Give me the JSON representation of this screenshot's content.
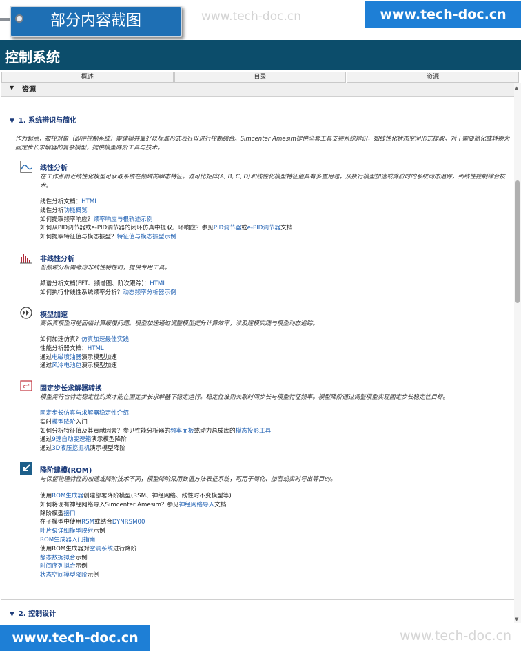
{
  "watermark": {
    "badge": "部分内容截图",
    "text": "www.tech-doc.cn",
    "url": "www.tech-doc.cn"
  },
  "header": {
    "title": "控制系统"
  },
  "tabs": [
    "概述",
    "目录",
    "资源"
  ],
  "resources": {
    "label": "资源"
  },
  "section1": {
    "title": "1. 系统辨识与简化",
    "intro": "作为起点，被控对象（即待控制系统）需建模并最好以标准形式表征以进行控制综合。Simcenter Amesim提供全套工具支持系统辨识，如线性化状态空间形式提取。对于需要简化或转换为固定步长求解器的复杂模型，提供模型降阶工具与技术。"
  },
  "linear": {
    "title": "线性分析",
    "desc": "在工作点附近线性化模型可获取系统在频域的瞬态特征。雅可比矩阵(A, B, C, D)和线性化模型特征值具有多重用途，从执行模型加速或降阶时的系统动态追踪，到线性控制综合技术。",
    "l1": "线性分析文档：",
    "l1_link": "HTML",
    "l2": "线性分析",
    "l2_link": "功能概览",
    "l3": "如何提取频率响应？",
    "l3_link": "频率响应与根轨迹示例",
    "l4a": "如何从PID调节器或e-PID调节器的闭环仿真中提取开环响应？参见",
    "l4b": "PID调节器",
    "l4c": "或",
    "l4d": "e-PID调节器",
    "l4e": "文档",
    "l5": "如何提取特征值与模态振型？",
    "l5_link": "特征值与模态振型示例"
  },
  "nonlinear": {
    "title": "非线性分析",
    "desc": "当频域分析需考虑非线性特性时，提供专用工具。",
    "l1": "频谱分析文档(FFT、频谱图、阶次跟踪)：",
    "l1_link": "HTML",
    "l2": "如何执行非线性系统频率分析？",
    "l2_link": "动态频率分析器示例"
  },
  "accel": {
    "title": "模型加速",
    "desc": "高保真模型可能面临计算缓慢问题。模型加速通过调整模型提升计算效率，涉及建模实践与模型动态追踪。",
    "l1": "如何加速仿真？",
    "l1_link": "仿真加速最佳实践",
    "l2": "性能分析器文档：",
    "l2_link": "HTML",
    "l3a": "通过",
    "l3b": "电磁喷油器",
    "l3c": "演示模型加速",
    "l4a": "通过",
    "l4b": "风冷电池包",
    "l4c": "演示模型加速"
  },
  "fixed": {
    "title": "固定步长求解器转换",
    "desc": "模型需符合特定稳定性约束才能在固定步长求解器下稳定运行。稳定性准则关联时间步长与模型特征频率。模型降阶通过调整模型实现固定步长稳定性目标。",
    "l1_link": "固定步长仿真与求解器稳定性介绍",
    "l2a": "实时",
    "l2b": "模型降阶",
    "l2c": "入门",
    "l3a": "如何分析特征值及其贡献因素？参见性能分析器的",
    "l3b": "频率面板",
    "l3c": "或动力总成库的",
    "l3d": "模态投影工具",
    "l4a": "通过",
    "l4b": "9速自动变速箱",
    "l4c": "演示模型降阶",
    "l5a": "通过",
    "l5b": "3D液压挖掘机",
    "l5c": "演示模型降阶"
  },
  "rom": {
    "title": "降阶建模(ROM)",
    "desc": "与保留物理特性的加速或降阶技术不同，模型降阶采用数值方法表征系统，可用于简化、加密或实时导出等目的。",
    "l1a": "使用",
    "l1b": "ROM生成器",
    "l1c": "创建部署降阶模型(RSM、神经网络、线性时不变模型等)",
    "l2a": "如何将现有神经网络导入Simcenter Amesim？参见",
    "l2b": "神经网络导入",
    "l2c": "文档",
    "l3a": "降阶模型",
    "l3b": "接口",
    "l4a": "在子模型中使用",
    "l4b": "RSM",
    "l4c": "或结合",
    "l4d": "DYNRSM00",
    "l5a": "叶片泵详细模型映射",
    "l5b": "示例",
    "l6": "ROM生成器入门指南",
    "l7a": "使用ROM生成器对",
    "l7b": "空调系统",
    "l7c": "进行降阶",
    "l8a": "静态数据拟合",
    "l8b": "示例",
    "l9a": "时间序列拟合",
    "l9b": "示例",
    "l10a": "状态空间模型降阶",
    "l10b": "示例"
  },
  "section2": {
    "title": "2. 控制设计"
  },
  "icons": [
    "linear-analysis-icon",
    "nonlinear-analysis-icon",
    "model-acceleration-icon",
    "fixed-step-icon",
    "rom-icon"
  ]
}
